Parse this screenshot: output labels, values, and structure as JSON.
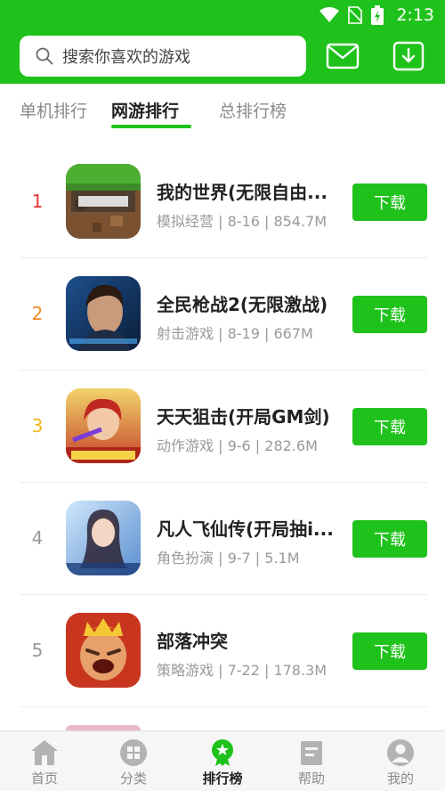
{
  "status": {
    "time": "2:13",
    "icons": [
      "wifi-icon",
      "no-sim-icon",
      "battery-charging-icon"
    ]
  },
  "search": {
    "placeholder": "搜索你喜欢的游戏"
  },
  "header_buttons": [
    "mail-icon",
    "download-icon"
  ],
  "tabs": [
    {
      "label": "单机排行",
      "active": false
    },
    {
      "label": "网游排行",
      "active": true
    },
    {
      "label": "总排行榜",
      "active": false
    }
  ],
  "games": [
    {
      "rank": "1",
      "rank_color": "#e53935",
      "name": "我的世界(无限自由...",
      "meta": "模拟经营 | 8-16 | 854.7M",
      "button": "下载"
    },
    {
      "rank": "2",
      "rank_color": "#f08a24",
      "name": "全民枪战2(无限激战)",
      "meta": "射击游戏 | 8-19 | 667M",
      "button": "下载"
    },
    {
      "rank": "3",
      "rank_color": "#f2b51c",
      "name": "天天狙击(开局GM剑)",
      "meta": "动作游戏 | 9-6 | 282.6M",
      "button": "下载"
    },
    {
      "rank": "4",
      "rank_color": "#999999",
      "name": "凡人飞仙传(开局抽i...",
      "meta": "角色扮演 | 9-7 | 5.1M",
      "button": "下载"
    },
    {
      "rank": "5",
      "rank_color": "#999999",
      "name": "部落冲突",
      "meta": "策略游戏 | 7-22 | 178.3M",
      "button": "下载"
    }
  ],
  "nav": [
    {
      "label": "首页",
      "icon": "home-icon",
      "active": false
    },
    {
      "label": "分类",
      "icon": "category-icon",
      "active": false
    },
    {
      "label": "排行榜",
      "icon": "ranking-icon",
      "active": true
    },
    {
      "label": "帮助",
      "icon": "help-icon",
      "active": false
    },
    {
      "label": "我的",
      "icon": "profile-icon",
      "active": false
    }
  ],
  "colors": {
    "brand_green": "#1fc21b"
  }
}
